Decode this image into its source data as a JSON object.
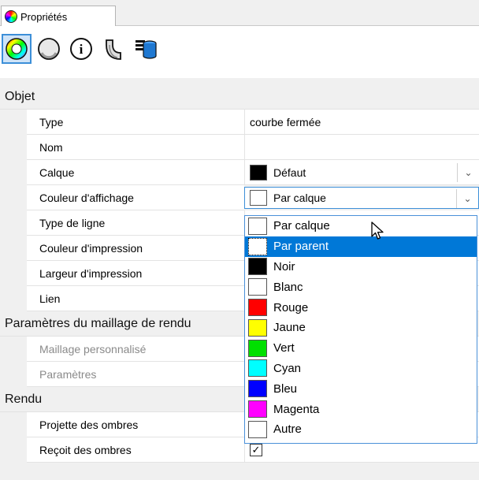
{
  "tab": {
    "label": "Propriétés"
  },
  "toolbar": {
    "buttons": [
      "object-properties",
      "material",
      "object-info",
      "curve-piping",
      "attribute-data"
    ]
  },
  "sections": {
    "objet": "Objet",
    "maillage": "Paramètres du maillage de rendu",
    "rendu": "Rendu"
  },
  "props": {
    "type_label": "Type",
    "type_value": "courbe fermée",
    "nom_label": "Nom",
    "nom_value": "",
    "calque_label": "Calque",
    "calque_value": "Défaut",
    "calque_color": "#000000",
    "couleur_aff_label": "Couleur d'affichage",
    "couleur_aff_value": "Par calque",
    "type_ligne_label": "Type de ligne",
    "couleur_imp_label": "Couleur d'impression",
    "largeur_imp_label": "Largeur d'impression",
    "lien_label": "Lien",
    "maillage_perso_label": "Maillage personnalisé",
    "parametres_label": "Paramètres",
    "projette_label": "Projette des ombres",
    "projette_checked": true,
    "recoit_label": "Reçoit des ombres",
    "recoit_checked": true
  },
  "dropdown": {
    "selected_index": 1,
    "items": [
      {
        "label": "Par calque",
        "color": "#ffffff"
      },
      {
        "label": "Par parent",
        "color": "#ffffff"
      },
      {
        "label": "Noir",
        "color": "#000000"
      },
      {
        "label": "Blanc",
        "color": "#ffffff"
      },
      {
        "label": "Rouge",
        "color": "#ff0000"
      },
      {
        "label": "Jaune",
        "color": "#ffff00"
      },
      {
        "label": "Vert",
        "color": "#00e000"
      },
      {
        "label": "Cyan",
        "color": "#00ffff"
      },
      {
        "label": "Bleu",
        "color": "#0000ff"
      },
      {
        "label": "Magenta",
        "color": "#ff00ff"
      },
      {
        "label": "Autre",
        "color": "#ffffff"
      }
    ]
  }
}
